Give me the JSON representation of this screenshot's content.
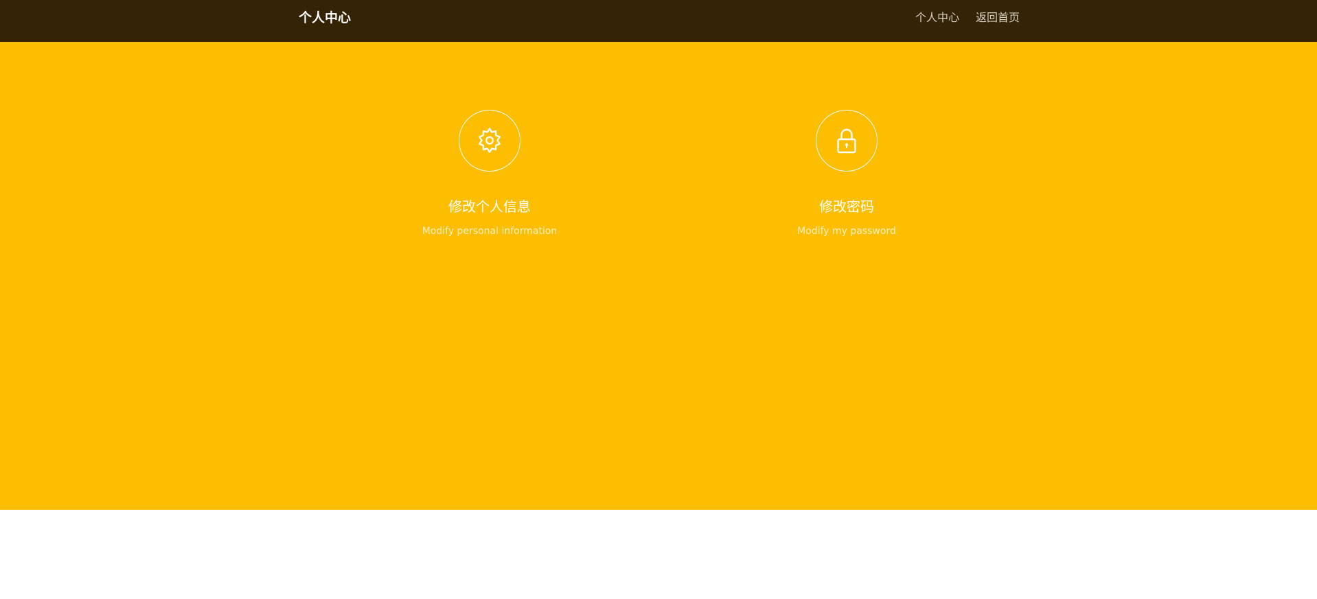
{
  "header": {
    "brand": "个人中心",
    "links": [
      {
        "label": "个人中心"
      },
      {
        "label": "返回首页"
      }
    ]
  },
  "features": [
    {
      "icon": "gear-icon",
      "title": "修改个人信息",
      "description": "Modify personal information"
    },
    {
      "icon": "lock-icon",
      "title": "修改密码",
      "description": "Modify my password"
    }
  ],
  "colors": {
    "navbar": "#342305",
    "hero": "#fdbd00",
    "icon": "#ffffff"
  }
}
